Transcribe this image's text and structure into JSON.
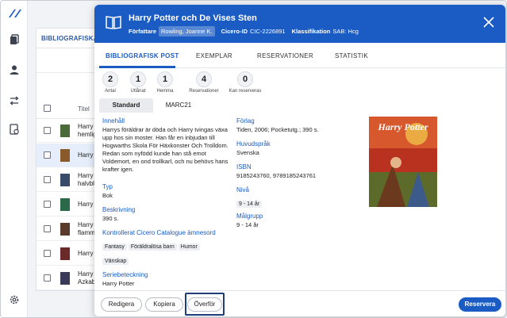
{
  "background": {
    "tab_label": "BIBLIOGRAFISKA POST",
    "column_title": "Titel",
    "rows": [
      {
        "title_line1": "Harry",
        "title_line2": "hemlig"
      },
      {
        "title_line1": "Harry",
        "title_line2": ""
      },
      {
        "title_line1": "Harry",
        "title_line2": "halvbl"
      },
      {
        "title_line1": "Harry",
        "title_line2": ""
      },
      {
        "title_line1": "Harry",
        "title_line2": "flamm"
      },
      {
        "title_line1": "Harry",
        "title_line2": ""
      },
      {
        "title_line1": "Harry",
        "title_line2": "Azkab"
      }
    ]
  },
  "modal": {
    "title": "Harry Potter och De Vises Sten",
    "author_label": "Författare",
    "author_value": "Rowling, Joanne K.",
    "cicero_label": "Cicero-ID",
    "cicero_value": "CIC-2226891",
    "class_label": "Klassifikation",
    "class_value": "SAB: Hcg",
    "tabs": [
      "BIBLIOGRAFISK POST",
      "EXEMPLAR",
      "RESERVATIONER",
      "STATISTIK"
    ],
    "stats": [
      {
        "value": "2",
        "label": "Antal"
      },
      {
        "value": "1",
        "label": "Utlånat"
      },
      {
        "value": "1",
        "label": "Hemma"
      },
      {
        "value": "4",
        "label": "Reservationer"
      },
      {
        "value": "0",
        "label": "Kan reserveras"
      }
    ],
    "subtabs": [
      "Standard",
      "MARC21"
    ],
    "fields": {
      "content_label": "Innehåll",
      "content_value": "Harrys föräldrar är döda och Harry tvingas växa upp hos sin moster. Han får en inbjudan till Hogwarths Skola För Häxkonster Och Trolldom. Redan som nyfödd kunde han stå emot Voldemort, en ond trollkarl, och nu behövs hans krafter igen.",
      "type_label": "Typ",
      "type_value": "Bok",
      "desc_label": "Beskrivning",
      "desc_value": "390 s.",
      "subjects_label": "Kontrollerat Cicero Catalogue ämnesord",
      "subjects": [
        "Fantasy",
        "Föräldralösa barn",
        "Humor",
        "Vänskap"
      ],
      "series_label": "Seriebeteckning",
      "series_value": "Harry Potter",
      "publisher_label": "Förlag",
      "publisher_value": "Tiden, 2006; Pocketutg.; 390 s.",
      "language_label": "Huvudspråk",
      "language_value": "Svenska",
      "isbn_label": "ISBN",
      "isbn_value": "9185243760, 9789185243761",
      "level_label": "Nivå",
      "level_value": "9 - 14 år",
      "audience_label": "Målgrupp",
      "audience_value": "9 - 14 år"
    },
    "cover_title": "Harry Potter",
    "footer": {
      "edit": "Redigera",
      "copy": "Kopiera",
      "transfer": "Överför",
      "reserve": "Reservera"
    }
  },
  "colors": {
    "brand": "#1a5bc4",
    "focus": "#1f3d7a"
  },
  "icons": [
    "logo-icon",
    "book-icon",
    "close-icon",
    "copy-icon",
    "user-icon",
    "transfer-icon",
    "document-icon",
    "gear-icon"
  ]
}
